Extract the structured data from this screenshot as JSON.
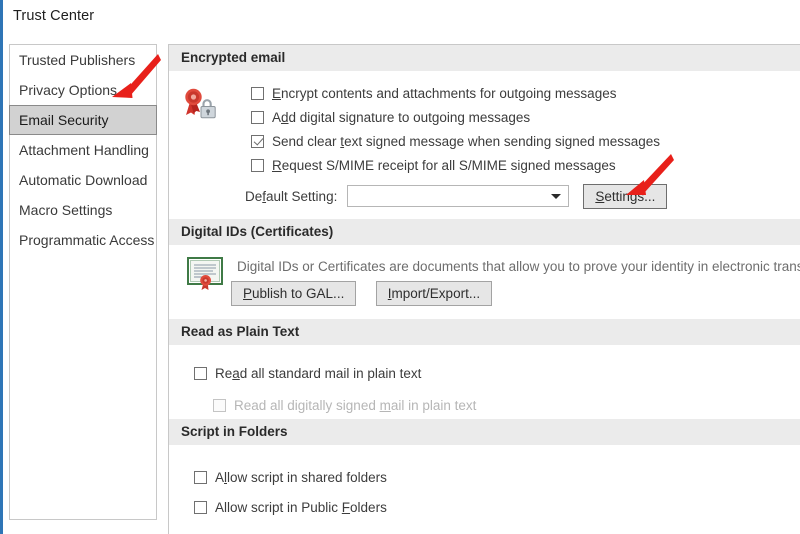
{
  "window": {
    "title": "Trust Center",
    "accent_color": "#2e75b6"
  },
  "sidebar": {
    "items": [
      {
        "label": "Trusted Publishers",
        "selected": false
      },
      {
        "label": "Privacy Options",
        "selected": false
      },
      {
        "label": "Email Security",
        "selected": true
      },
      {
        "label": "Attachment Handling",
        "selected": false
      },
      {
        "label": "Automatic Download",
        "selected": false
      },
      {
        "label": "Macro Settings",
        "selected": false
      },
      {
        "label": "Programmatic Access",
        "selected": false
      }
    ]
  },
  "sections": {
    "encrypted_email": {
      "heading": "Encrypted email",
      "icon": "certificate-lock-icon",
      "checkboxes": [
        {
          "label_pre": "",
          "label_accel": "E",
          "label_post": "ncrypt contents and attachments for outgoing messages",
          "checked": false,
          "disabled": false
        },
        {
          "label_pre": "A",
          "label_accel": "d",
          "label_post": "d digital signature to outgoing messages",
          "checked": false,
          "disabled": false
        },
        {
          "label_pre": "Send clear ",
          "label_accel": "t",
          "label_post": "ext signed message when sending signed messages",
          "checked": true,
          "disabled": false
        },
        {
          "label_pre": "",
          "label_accel": "R",
          "label_post": "equest S/MIME receipt for all S/MIME signed messages",
          "checked": false,
          "disabled": false
        }
      ],
      "default_setting": {
        "label_pre": "De",
        "label_accel": "f",
        "label_post": "ault Setting:",
        "value": "",
        "placeholder": ""
      },
      "settings_button": {
        "label_pre": "",
        "label_accel": "S",
        "label_post": "ettings..."
      }
    },
    "digital_ids": {
      "heading": "Digital IDs (Certificates)",
      "icon": "certificate-document-icon",
      "description": "Digital IDs or Certificates are documents that allow you to prove your identity in electronic transactions.",
      "buttons": [
        {
          "label_pre": "",
          "label_accel": "P",
          "label_post": "ublish to GAL..."
        },
        {
          "label_pre": "",
          "label_accel": "I",
          "label_post": "mport/Export..."
        }
      ]
    },
    "read_as_plain_text": {
      "heading": "Read as Plain Text",
      "checkboxes": [
        {
          "label_pre": "Re",
          "label_accel": "a",
          "label_post": "d all standard mail in plain text",
          "checked": false,
          "disabled": false,
          "indented": false
        },
        {
          "label_pre": "Read all digitally signed ",
          "label_accel": "m",
          "label_post": "ail in plain text",
          "checked": false,
          "disabled": true,
          "indented": true
        }
      ]
    },
    "script_in_folders": {
      "heading": "Script in Folders",
      "checkboxes": [
        {
          "label_pre": "A",
          "label_accel": "l",
          "label_post": "low script in shared folders",
          "checked": false,
          "disabled": false
        },
        {
          "label_pre": "Allow script in Public ",
          "label_accel": "F",
          "label_post": "olders",
          "checked": false,
          "disabled": false
        }
      ]
    }
  },
  "annotations": {
    "arrow_color": "#e8201a",
    "arrows": [
      {
        "name": "arrow-pointing-to-email-security",
        "target": "Email Security category"
      },
      {
        "name": "arrow-pointing-to-settings-button",
        "target": "Settings... button"
      }
    ]
  }
}
